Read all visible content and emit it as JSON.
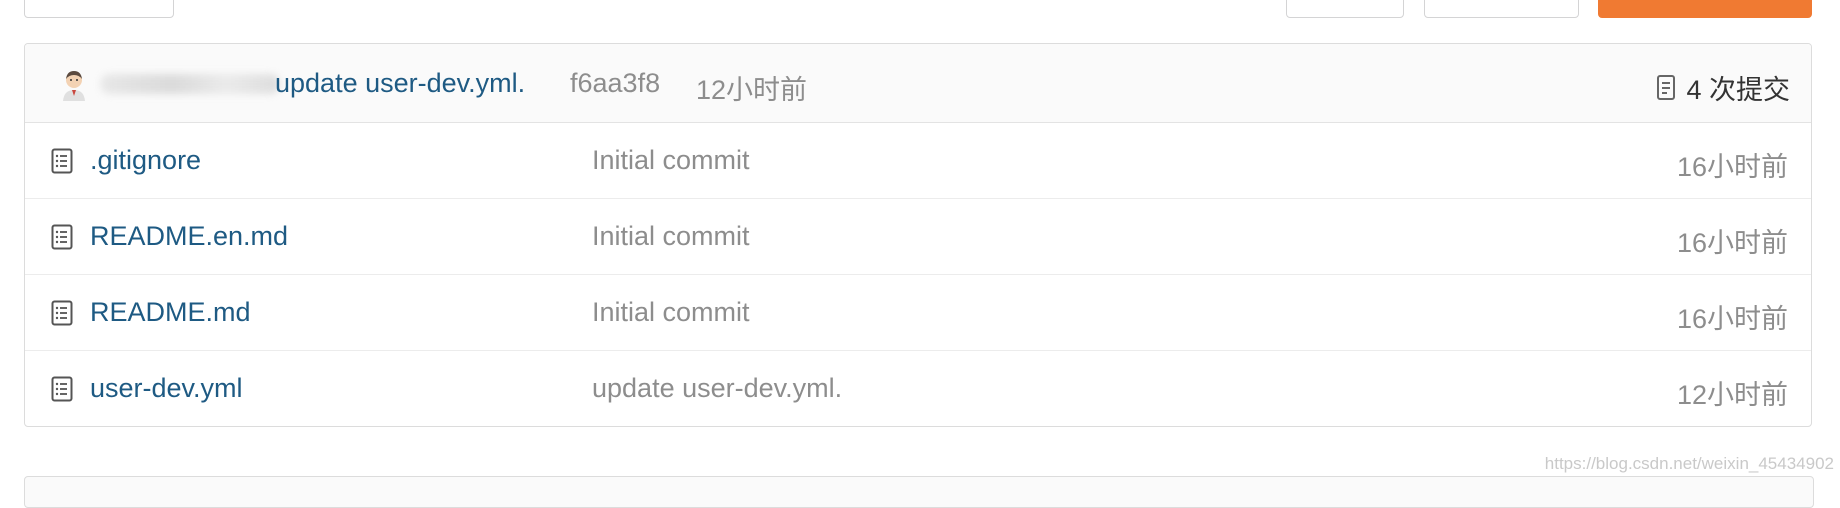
{
  "commit_bar": {
    "message": "update user-dev.yml.",
    "hash": "f6aa3f8",
    "time": "12小时前",
    "count_label": "4 次提交"
  },
  "files": [
    {
      "name": ".gitignore",
      "message": "Initial commit",
      "time": "16小时前"
    },
    {
      "name": "README.en.md",
      "message": "Initial commit",
      "time": "16小时前"
    },
    {
      "name": "README.md",
      "message": "Initial commit",
      "time": "16小时前"
    },
    {
      "name": "user-dev.yml",
      "message": "update user-dev.yml.",
      "time": "12小时前"
    }
  ],
  "watermark": "https://blog.csdn.net/weixin_45434902",
  "colors": {
    "link": "#1e5a83",
    "muted": "#8d8d8d",
    "primary": "#f07a32"
  },
  "icons": {
    "file": "file-text-icon",
    "commits": "commit-log-icon"
  }
}
